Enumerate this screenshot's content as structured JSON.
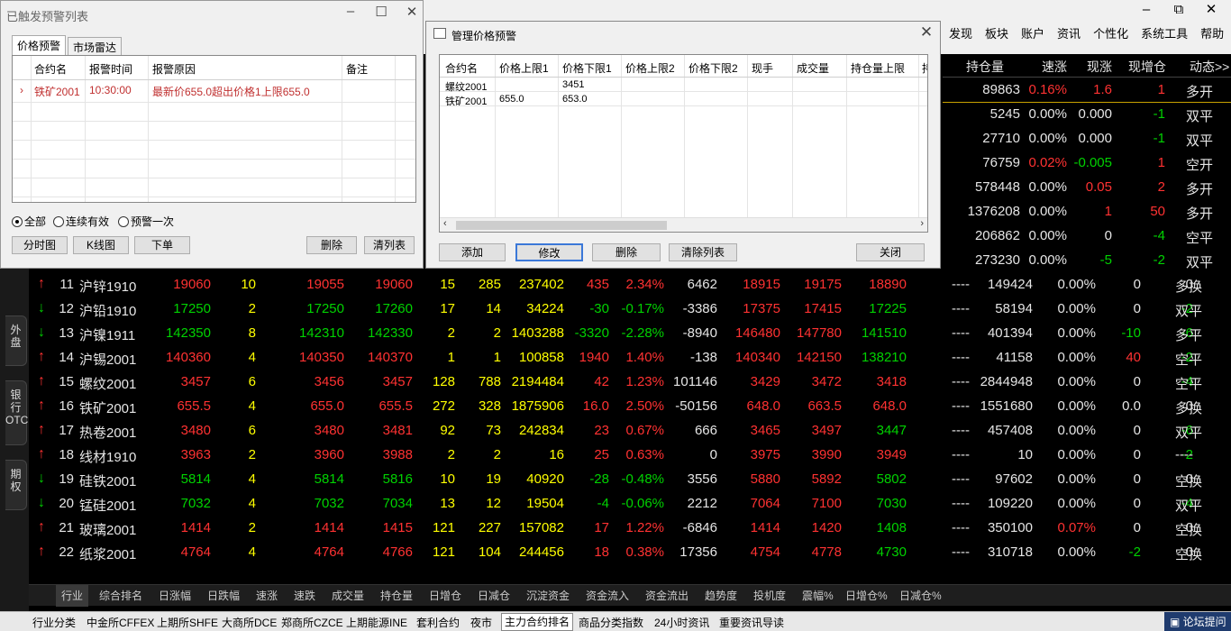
{
  "menu": [
    "发现",
    "板块",
    "账户",
    "资讯",
    "个性化",
    "系统工具",
    "帮助"
  ],
  "window_controls": {
    "minimize": "–",
    "restore": "⧉",
    "close": "✕"
  },
  "quote_header": {
    "oi": "持仓量",
    "speed": "速涨",
    "chg_now": "现涨",
    "oi_inc": "现增仓",
    "dynamic": "动态>>"
  },
  "left_tabs": [
    "外盘",
    "银行OTC",
    "期权"
  ],
  "upper_rows": [
    {
      "oi": "89863",
      "speed": "0.16%",
      "chg": "1.6",
      "inc": "1",
      "dyn": "多开",
      "highlight": true,
      "c_speed": "red",
      "c_chg": "red",
      "c_inc": "red"
    },
    {
      "oi": "5245",
      "speed": "0.00%",
      "chg": "0.000",
      "inc": "-1",
      "dyn": "双平",
      "c_speed": "white",
      "c_chg": "white",
      "c_inc": "green"
    },
    {
      "oi": "27710",
      "speed": "0.00%",
      "chg": "0.000",
      "inc": "-1",
      "dyn": "双平",
      "c_speed": "white",
      "c_chg": "white",
      "c_inc": "green"
    },
    {
      "oi": "76759",
      "speed": "0.02%",
      "chg": "-0.005",
      "inc": "1",
      "dyn": "空开",
      "c_speed": "red",
      "c_chg": "green",
      "c_inc": "red"
    },
    {
      "oi": "578448",
      "speed": "0.00%",
      "chg": "0.05",
      "inc": "2",
      "dyn": "多开",
      "c_speed": "white",
      "c_chg": "red",
      "c_inc": "red"
    },
    {
      "oi": "1376208",
      "speed": "0.00%",
      "chg": "1",
      "inc": "50",
      "dyn": "多开",
      "c_speed": "white",
      "c_chg": "red",
      "c_inc": "red"
    },
    {
      "oi": "206862",
      "speed": "0.00%",
      "chg": "0",
      "inc": "-4",
      "dyn": "空平",
      "c_speed": "white",
      "c_chg": "white",
      "c_inc": "green"
    },
    {
      "oi": "273230",
      "speed": "0.00%",
      "chg": "-5",
      "inc": "-2",
      "dyn": "双平",
      "c_speed": "white",
      "c_chg": "green",
      "c_inc": "green"
    }
  ],
  "rows": [
    {
      "dir": "up",
      "no": "11",
      "name": "沪锌1910",
      "last": "19060",
      "vol_now": "10",
      "bid": "19055",
      "ask": "19060",
      "bidv": "15",
      "askv": "285",
      "vol": "237402",
      "chg": "435",
      "pct": "2.34%",
      "oichg": "6462",
      "open": "18915",
      "high": "19175",
      "low": "18890",
      "pre": "----",
      "oi": "149424",
      "speed": "0.00%",
      "chg_now": "0",
      "inc": "0",
      "dyn": "多换",
      "c": "red",
      "c_speed": "white",
      "c_chg_now": "white",
      "c_inc": "white",
      "c_open": "red",
      "c_high": "red",
      "c_low": "red"
    },
    {
      "dir": "down",
      "no": "12",
      "name": "沪铅1910",
      "last": "17250",
      "vol_now": "2",
      "bid": "17250",
      "ask": "17260",
      "bidv": "17",
      "askv": "14",
      "vol": "34224",
      "chg": "-30",
      "pct": "-0.17%",
      "oichg": "-3386",
      "open": "17375",
      "high": "17415",
      "low": "17225",
      "pre": "----",
      "oi": "58194",
      "speed": "0.00%",
      "chg_now": "0",
      "inc": "-2",
      "dyn": "双平",
      "c": "green",
      "c_speed": "white",
      "c_chg_now": "white",
      "c_inc": "green",
      "c_open": "red",
      "c_high": "red",
      "c_low": "green"
    },
    {
      "dir": "down",
      "no": "13",
      "name": "沪镍1911",
      "last": "142350",
      "vol_now": "8",
      "bid": "142310",
      "ask": "142330",
      "bidv": "2",
      "askv": "2",
      "vol": "1403288",
      "chg": "-3320",
      "pct": "-2.28%",
      "oichg": "-8940",
      "open": "146480",
      "high": "147780",
      "low": "141510",
      "pre": "----",
      "oi": "401394",
      "speed": "0.00%",
      "chg_now": "-10",
      "inc": "-6",
      "dyn": "多平",
      "c": "green",
      "c_speed": "white",
      "c_chg_now": "green",
      "c_inc": "green",
      "c_open": "red",
      "c_high": "red",
      "c_low": "green"
    },
    {
      "dir": "up",
      "no": "14",
      "name": "沪锡2001",
      "last": "140360",
      "vol_now": "4",
      "bid": "140350",
      "ask": "140370",
      "bidv": "1",
      "askv": "1",
      "vol": "100858",
      "chg": "1940",
      "pct": "1.40%",
      "oichg": "-138",
      "open": "140340",
      "high": "142150",
      "low": "138210",
      "pre": "----",
      "oi": "41158",
      "speed": "0.00%",
      "chg_now": "40",
      "inc": "-2",
      "dyn": "空平",
      "c": "red",
      "c_speed": "white",
      "c_chg_now": "red",
      "c_inc": "green",
      "c_open": "red",
      "c_high": "red",
      "c_low": "green"
    },
    {
      "dir": "up",
      "no": "15",
      "name": "螺纹2001",
      "last": "3457",
      "vol_now": "6",
      "bid": "3456",
      "ask": "3457",
      "bidv": "128",
      "askv": "788",
      "vol": "2194484",
      "chg": "42",
      "pct": "1.23%",
      "oichg": "101146",
      "open": "3429",
      "high": "3472",
      "low": "3418",
      "pre": "----",
      "oi": "2844948",
      "speed": "0.00%",
      "chg_now": "0",
      "inc": "-4",
      "dyn": "空平",
      "c": "red",
      "c_speed": "white",
      "c_chg_now": "white",
      "c_inc": "green",
      "c_open": "red",
      "c_high": "red",
      "c_low": "red"
    },
    {
      "dir": "up",
      "no": "16",
      "name": "铁矿2001",
      "last": "655.5",
      "vol_now": "4",
      "bid": "655.0",
      "ask": "655.5",
      "bidv": "272",
      "askv": "328",
      "vol": "1875906",
      "chg": "16.0",
      "pct": "2.50%",
      "oichg": "-50156",
      "open": "648.0",
      "high": "663.5",
      "low": "648.0",
      "pre": "----",
      "oi": "1551680",
      "speed": "0.00%",
      "chg_now": "0.0",
      "inc": "0",
      "dyn": "多换",
      "c": "red",
      "c_speed": "white",
      "c_chg_now": "white",
      "c_inc": "white",
      "c_open": "red",
      "c_high": "red",
      "c_low": "red"
    },
    {
      "dir": "up",
      "no": "17",
      "name": "热卷2001",
      "last": "3480",
      "vol_now": "6",
      "bid": "3480",
      "ask": "3481",
      "bidv": "92",
      "askv": "73",
      "vol": "242834",
      "chg": "23",
      "pct": "0.67%",
      "oichg": "666",
      "open": "3465",
      "high": "3497",
      "low": "3447",
      "pre": "----",
      "oi": "457408",
      "speed": "0.00%",
      "chg_now": "0",
      "inc": "-6",
      "dyn": "双平",
      "c": "red",
      "c_speed": "white",
      "c_chg_now": "white",
      "c_inc": "green",
      "c_open": "red",
      "c_high": "red",
      "c_low": "green"
    },
    {
      "dir": "up",
      "no": "18",
      "name": "线材1910",
      "last": "3963",
      "vol_now": "2",
      "bid": "3960",
      "ask": "3988",
      "bidv": "2",
      "askv": "2",
      "vol": "16",
      "chg": "25",
      "pct": "0.63%",
      "oichg": "0",
      "open": "3975",
      "high": "3990",
      "low": "3949",
      "pre": "----",
      "oi": "10",
      "speed": "0.00%",
      "chg_now": "0",
      "inc": "-2",
      "dyn": "----",
      "c": "red",
      "c_speed": "white",
      "c_chg_now": "white",
      "c_inc": "green",
      "c_open": "red",
      "c_high": "red",
      "c_low": "red"
    },
    {
      "dir": "down",
      "no": "19",
      "name": "硅铁2001",
      "last": "5814",
      "vol_now": "4",
      "bid": "5814",
      "ask": "5816",
      "bidv": "10",
      "askv": "19",
      "vol": "40920",
      "chg": "-28",
      "pct": "-0.48%",
      "oichg": "3556",
      "open": "5880",
      "high": "5892",
      "low": "5802",
      "pre": "----",
      "oi": "97602",
      "speed": "0.00%",
      "chg_now": "0",
      "inc": "0",
      "dyn": "空换",
      "c": "green",
      "c_speed": "white",
      "c_chg_now": "white",
      "c_inc": "white",
      "c_open": "red",
      "c_high": "red",
      "c_low": "green"
    },
    {
      "dir": "down",
      "no": "20",
      "name": "锰硅2001",
      "last": "7032",
      "vol_now": "4",
      "bid": "7032",
      "ask": "7034",
      "bidv": "13",
      "askv": "12",
      "vol": "19504",
      "chg": "-4",
      "pct": "-0.06%",
      "oichg": "2212",
      "open": "7064",
      "high": "7100",
      "low": "7030",
      "pre": "----",
      "oi": "109220",
      "speed": "0.00%",
      "chg_now": "0",
      "inc": "-4",
      "dyn": "双平",
      "c": "green",
      "c_speed": "white",
      "c_chg_now": "white",
      "c_inc": "green",
      "c_open": "red",
      "c_high": "red",
      "c_low": "green"
    },
    {
      "dir": "up",
      "no": "21",
      "name": "玻璃2001",
      "last": "1414",
      "vol_now": "2",
      "bid": "1414",
      "ask": "1415",
      "bidv": "121",
      "askv": "227",
      "vol": "157082",
      "chg": "17",
      "pct": "1.22%",
      "oichg": "-6846",
      "open": "1414",
      "high": "1420",
      "low": "1408",
      "pre": "----",
      "oi": "350100",
      "speed": "0.07%",
      "chg_now": "0",
      "inc": "0",
      "dyn": "空换",
      "c": "red",
      "c_speed": "red",
      "c_chg_now": "white",
      "c_inc": "white",
      "c_open": "red",
      "c_high": "red",
      "c_low": "green"
    },
    {
      "dir": "up",
      "no": "22",
      "name": "纸浆2001",
      "last": "4764",
      "vol_now": "4",
      "bid": "4764",
      "ask": "4766",
      "bidv": "121",
      "askv": "104",
      "vol": "244456",
      "chg": "18",
      "pct": "0.38%",
      "oichg": "17356",
      "open": "4754",
      "high": "4778",
      "low": "4730",
      "pre": "----",
      "oi": "310718",
      "speed": "0.00%",
      "chg_now": "-2",
      "inc": "0",
      "dyn": "空换",
      "c": "red",
      "c_speed": "white",
      "c_chg_now": "green",
      "c_inc": "white",
      "c_open": "red",
      "c_high": "red",
      "c_low": "green"
    }
  ],
  "sort_tabs": [
    "行业",
    "综合排名",
    "日涨幅",
    "日跌幅",
    "速涨",
    "速跌",
    "成交量",
    "持仓量",
    "日增仓",
    "日减仓",
    "沉淀资金",
    "资金流入",
    "资金流出",
    "趋势度",
    "投机度",
    "震幅%",
    "日增仓%",
    "日减仓%"
  ],
  "exchange_tabs": [
    "行业分类",
    "中金所CFFEX",
    "上期所SHFE",
    "大商所DCE",
    "郑商所CZCE",
    "上期能源INE",
    "套利合约",
    "夜市",
    "主力合约排名",
    "商品分类指数",
    "24小时资讯",
    "重要资讯导读"
  ],
  "forum_label": "论坛提问",
  "dlg1": {
    "title": "已触发预警列表",
    "tabs": [
      "价格预警",
      "市场雷达"
    ],
    "headers": [
      "合约名",
      "报警时间",
      "报警原因",
      "备注"
    ],
    "row": {
      "marker": "›",
      "name": "铁矿2001",
      "time": "10:30:00",
      "reason": "最新价655.0超出价格1上限655.0",
      "note": ""
    },
    "radios": [
      "全部",
      "连续有效",
      "预警一次"
    ],
    "buttons": {
      "tick": "分时图",
      "kline": "K线图",
      "order": "下单",
      "delete": "删除",
      "clear": "清列表"
    }
  },
  "dlg2": {
    "title": "管理价格预警",
    "headers": [
      "合约名",
      "价格上限1",
      "价格下限1",
      "价格上限2",
      "价格下限2",
      "现手",
      "成交量",
      "持仓量上限",
      "持"
    ],
    "rows": [
      {
        "name": "螺纹2001",
        "up1": "",
        "down1": "3451"
      },
      {
        "name": "铁矿2001",
        "up1": "655.0",
        "down1": "653.0"
      }
    ],
    "buttons": {
      "add": "添加",
      "edit": "修改",
      "delete": "删除",
      "clear": "清除列表",
      "close": "关闭"
    }
  },
  "colors": {
    "red": "#ff3232",
    "green": "#00d200",
    "white": "#e6e6e6",
    "yellow": "#ffff00"
  }
}
